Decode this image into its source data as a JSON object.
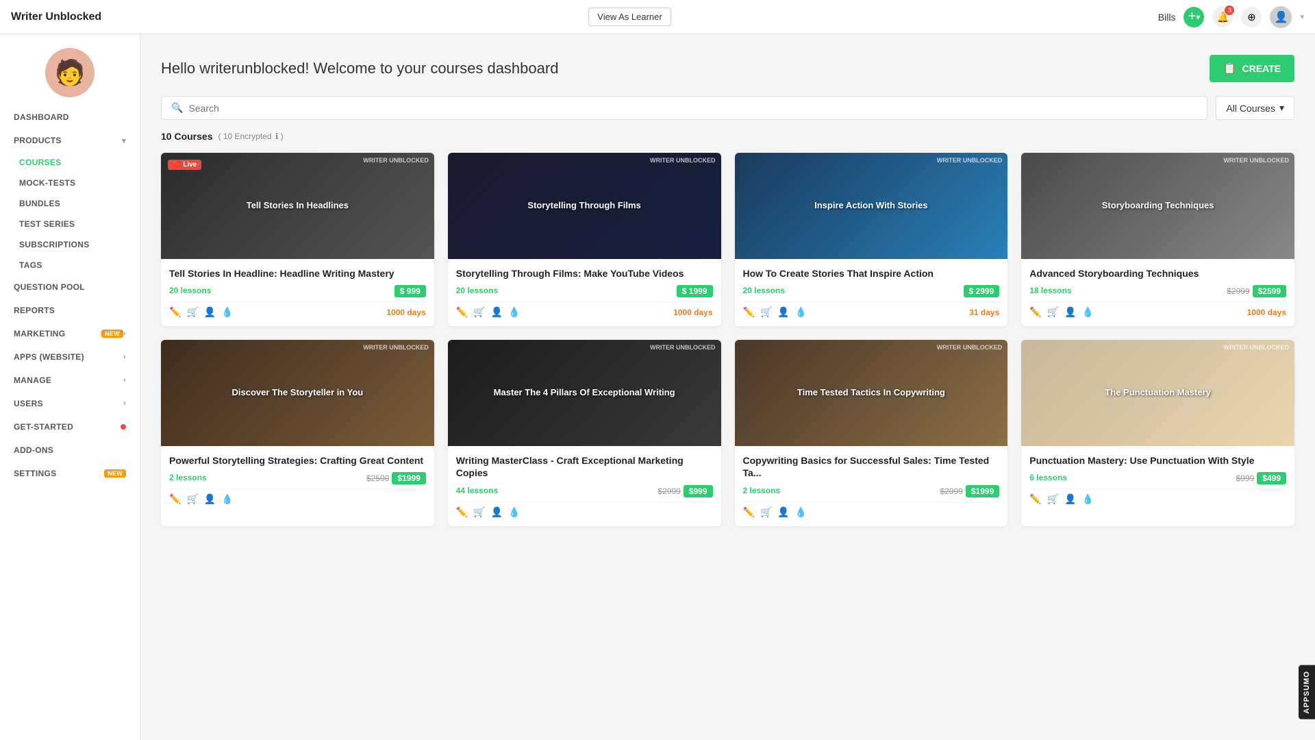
{
  "app": {
    "name": "Writer Unblocked",
    "user": "Bills"
  },
  "topNav": {
    "view_as_learner": "View As Learner",
    "add_icon": "+",
    "notification_count": "3"
  },
  "sidebar": {
    "avatar_emoji": "🧑",
    "items": [
      {
        "id": "dashboard",
        "label": "DASHBOARD",
        "hasChevron": false,
        "active": false
      },
      {
        "id": "products",
        "label": "PRODUCTS",
        "hasChevron": true,
        "active": false
      },
      {
        "id": "courses",
        "label": "COURSES",
        "hasChevron": false,
        "active": true,
        "sub": true
      },
      {
        "id": "mock-tests",
        "label": "MOCK-TESTS",
        "hasChevron": false,
        "sub": true
      },
      {
        "id": "bundles",
        "label": "BUNDLES",
        "hasChevron": false,
        "sub": true
      },
      {
        "id": "test-series",
        "label": "TEST SERIES",
        "hasChevron": false,
        "sub": true
      },
      {
        "id": "subscriptions",
        "label": "SUBSCRIPTIONS",
        "hasChevron": false,
        "sub": true
      },
      {
        "id": "tags",
        "label": "TAGS",
        "hasChevron": false,
        "sub": true
      },
      {
        "id": "question-pool",
        "label": "QUESTION POOL",
        "hasChevron": false
      },
      {
        "id": "reports",
        "label": "REPORTS",
        "hasChevron": false
      },
      {
        "id": "marketing",
        "label": "MARKETING",
        "hasChevron": true,
        "badge": "NEW"
      },
      {
        "id": "apps-website",
        "label": "APPS (WEBSITE)",
        "hasChevron": true
      },
      {
        "id": "manage",
        "label": "MANAGE",
        "hasChevron": true
      },
      {
        "id": "users",
        "label": "USERS",
        "hasChevron": true
      },
      {
        "id": "get-started",
        "label": "GET-STARTED",
        "hasChevron": false,
        "dotBadge": true
      },
      {
        "id": "add-ons",
        "label": "ADD-ONS",
        "hasChevron": false
      },
      {
        "id": "settings",
        "label": "SETTINGS",
        "hasChevron": false,
        "badge": "NEW"
      }
    ]
  },
  "main": {
    "welcome_message": "Hello writerunblocked! Welcome to your courses dashboard",
    "create_button": "CREATE",
    "search_placeholder": "Search",
    "filter_label": "All Courses",
    "courses_count": "10 Courses",
    "encrypted_label": "( 10 Encrypted",
    "courses": [
      {
        "id": 1,
        "title": "Tell Stories In Headline: Headline Writing Mastery",
        "thumb_style": "thumb-dark",
        "thumb_text": "Tell Stories In Headlines",
        "lessons": "20 lessons",
        "price": "$ 999",
        "duration": "1000 days",
        "live": true,
        "original_price": null
      },
      {
        "id": 2,
        "title": "Storytelling Through Films: Make YouTube Videos",
        "thumb_style": "thumb-dark2",
        "thumb_text": "Storytelling Through Films",
        "lessons": "20 lessons",
        "price": "$ 1999",
        "duration": "1000 days",
        "live": false,
        "original_price": null
      },
      {
        "id": 3,
        "title": "How To Create Stories That Inspire Action",
        "thumb_style": "thumb-blue",
        "thumb_text": "Inspire Action With Stories",
        "lessons": "20 lessons",
        "price": "$ 2999",
        "duration": "31 days",
        "live": false,
        "original_price": null
      },
      {
        "id": 4,
        "title": "Advanced Storyboarding Techniques",
        "thumb_style": "thumb-gray",
        "thumb_text": "Storyboarding Techniques",
        "lessons": "18 lessons",
        "price": "$2599",
        "duration": "1000 days",
        "live": false,
        "original_price": "$2999"
      },
      {
        "id": 5,
        "title": "Powerful Storytelling Strategies: Crafting Great Content",
        "thumb_style": "thumb-warm",
        "thumb_text": "Discover The Storyteller in You",
        "lessons": "2 lessons",
        "price": "$1999",
        "duration": "",
        "live": false,
        "original_price": "$2500"
      },
      {
        "id": 6,
        "title": "Writing MasterClass - Craft Exceptional Marketing Copies",
        "thumb_style": "thumb-dark3",
        "thumb_text": "Master The 4 Pillars Of Exceptional Writing",
        "lessons": "44 lessons",
        "price": "$999",
        "duration": "",
        "live": false,
        "original_price": "$2999"
      },
      {
        "id": 7,
        "title": "Copywriting Basics for Successful Sales: Time Tested Ta...",
        "thumb_style": "thumb-brown",
        "thumb_text": "Time Tested Tactics In Copywriting",
        "lessons": "2 lessons",
        "price": "$1999",
        "duration": "",
        "live": false,
        "original_price": "$2999"
      },
      {
        "id": 8,
        "title": "Punctuation Mastery: Use Punctuation With Style",
        "thumb_style": "thumb-light",
        "thumb_text": "The Punctuation Mastery",
        "lessons": "6 lessons",
        "price": "$499",
        "duration": "",
        "live": false,
        "original_price": "$999"
      }
    ]
  },
  "appsumo": {
    "label": "APPSUMO"
  }
}
